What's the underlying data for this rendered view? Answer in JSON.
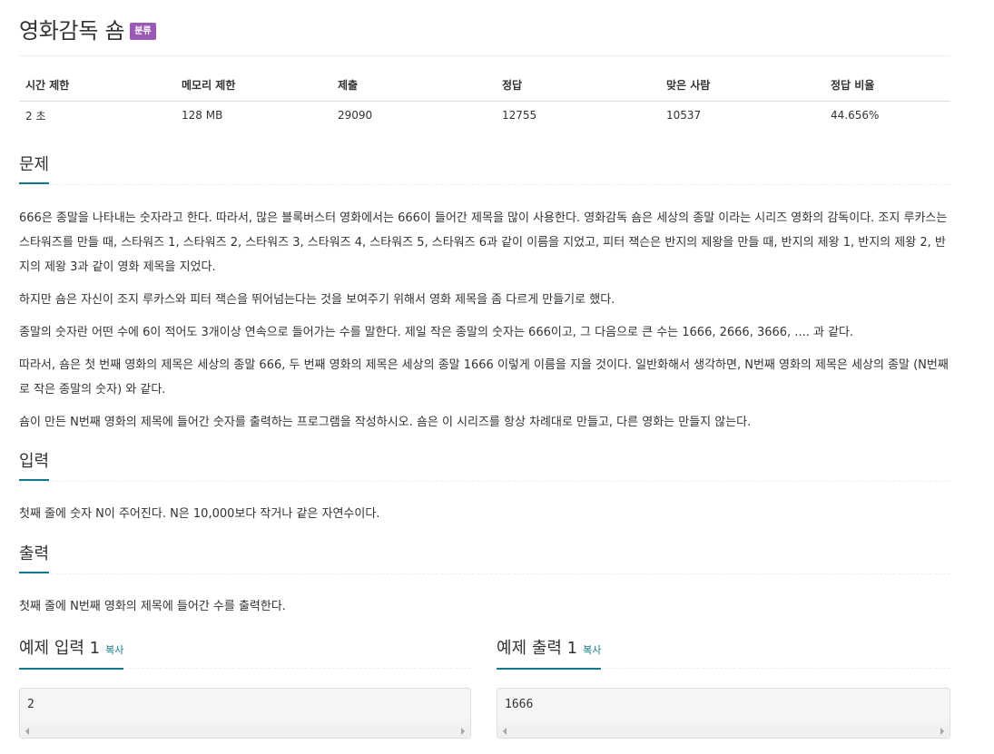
{
  "problem": {
    "title": "영화감독 숌",
    "category_badge": "분류"
  },
  "info_table": {
    "headers": [
      "시간 제한",
      "메모리 제한",
      "제출",
      "정답",
      "맞은 사람",
      "정답 비율"
    ],
    "values": [
      "2 초",
      "128 MB",
      "29090",
      "12755",
      "10537",
      "44.656%"
    ]
  },
  "description": {
    "heading": "문제",
    "paragraphs": [
      "666은 종말을 나타내는 숫자라고 한다. 따라서, 많은 블록버스터 영화에서는 666이 들어간 제목을 많이 사용한다. 영화감독 숌은 세상의 종말 이라는 시리즈 영화의 감독이다. 조지 루카스는 스타워즈를 만들 때, 스타워즈 1, 스타워즈 2, 스타워즈 3, 스타워즈 4, 스타워즈 5, 스타워즈 6과 같이 이름을 지었고, 피터 잭슨은 반지의 제왕을 만들 때, 반지의 제왕 1, 반지의 제왕 2, 반지의 제왕 3과 같이 영화 제목을 지었다.",
      "하지만 숌은 자신이 조지 루카스와 피터 잭슨을 뛰어넘는다는 것을 보여주기 위해서 영화 제목을 좀 다르게 만들기로 했다.",
      "종말의 숫자란 어떤 수에 6이 적어도 3개이상 연속으로 들어가는 수를 말한다. 제일 작은 종말의 숫자는 666이고, 그 다음으로 큰 수는 1666, 2666, 3666, .... 과 같다.",
      "따라서, 숌은 첫 번째 영화의 제목은 세상의 종말 666, 두 번째 영화의 제목은 세상의 종말 1666 이렇게 이름을 지을 것이다. 일반화해서 생각하면, N번째 영화의 제목은 세상의 종말 (N번째로 작은 종말의 숫자) 와 같다.",
      "숌이 만든 N번째 영화의 제목에 들어간 숫자를 출력하는 프로그램을 작성하시오. 숌은 이 시리즈를 항상 차례대로 만들고, 다른 영화는 만들지 않는다."
    ]
  },
  "input": {
    "heading": "입력",
    "text": "첫째 줄에 숫자 N이 주어진다. N은 10,000보다 작거나 같은 자연수이다."
  },
  "output": {
    "heading": "출력",
    "text": "첫째 줄에 N번째 영화의 제목에 들어간 수를 출력한다."
  },
  "samples": {
    "input": {
      "title": "예제 입력 1",
      "copy_label": "복사",
      "content": "2"
    },
    "output": {
      "title": "예제 출력 1",
      "copy_label": "복사",
      "content": "1666"
    }
  },
  "colors": {
    "accent": "#0e7a8c",
    "badge": "#9b59b6"
  }
}
